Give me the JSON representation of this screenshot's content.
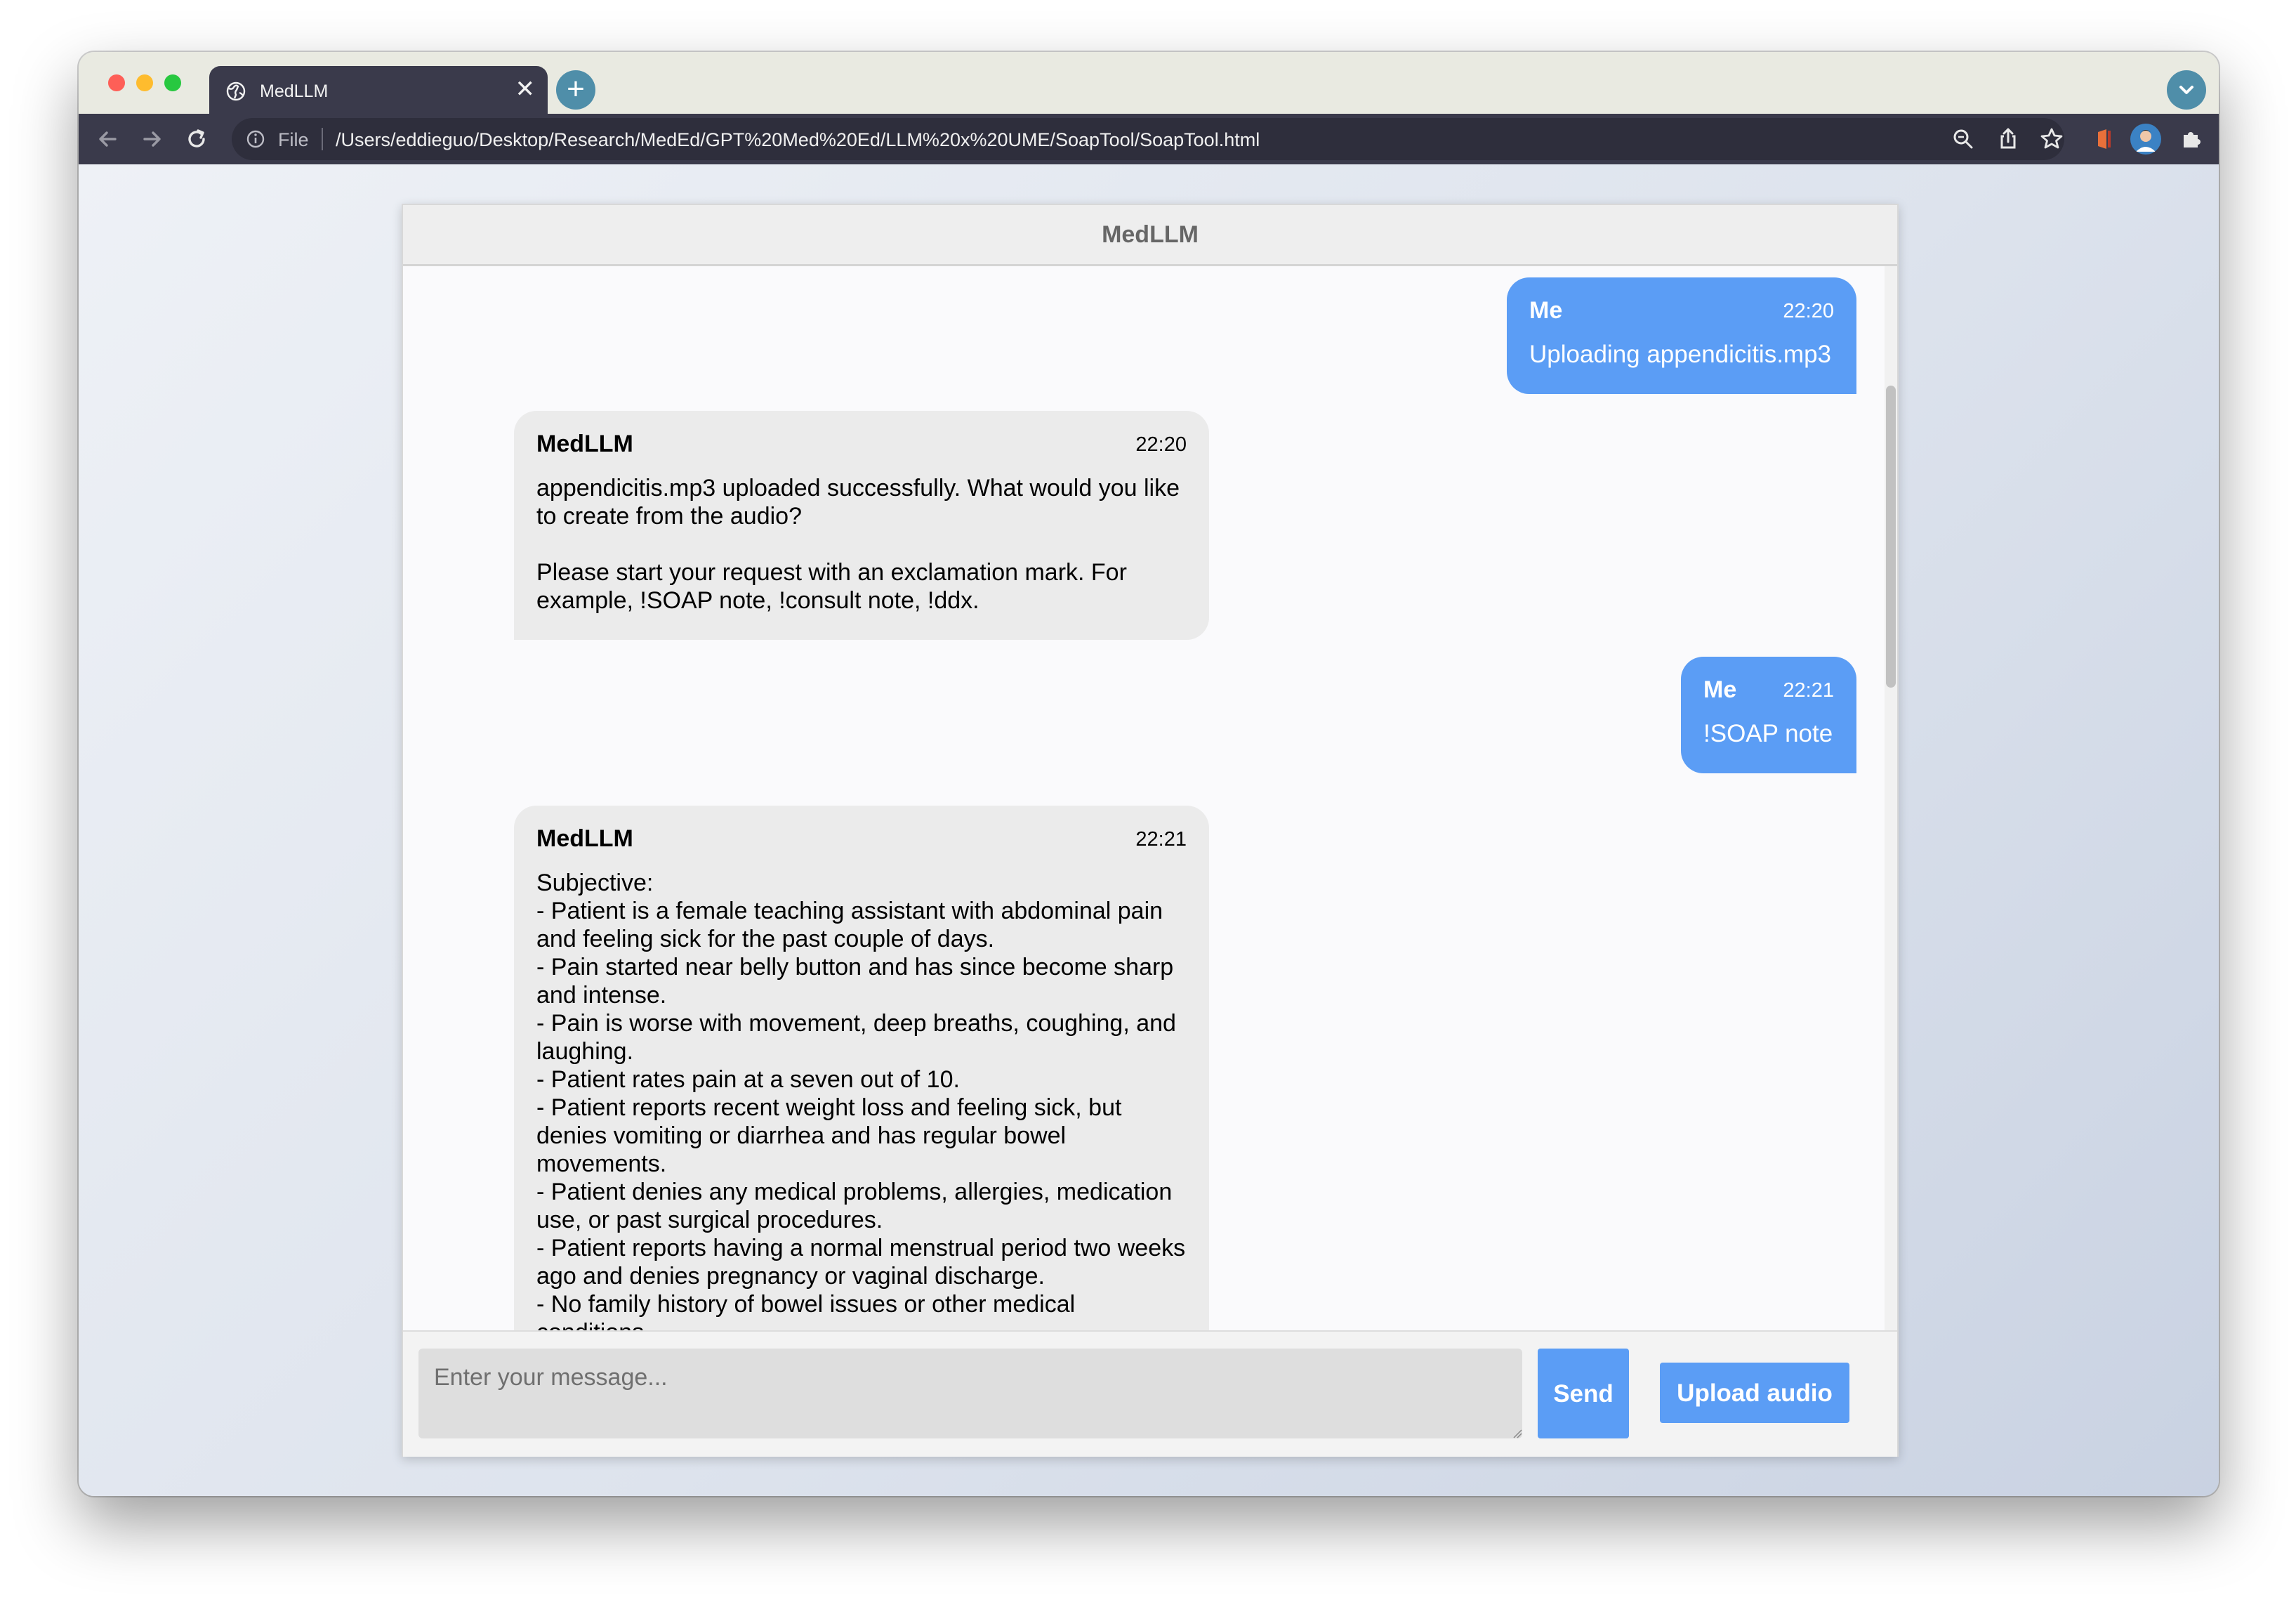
{
  "browser": {
    "tab_title": "MedLLM",
    "new_tab_label": "+",
    "close_tab_label": "✕",
    "url_scheme": "File",
    "url": "/Users/eddieguo/Desktop/Research/MedEd/GPT%20Med%20Ed/LLM%20x%20UME/SoapTool/SoapTool.html",
    "icons": [
      "back-icon",
      "forward-icon",
      "reload-icon",
      "info-icon",
      "zoom-icon",
      "share-icon",
      "bookmark-star-icon",
      "extension-flag-icon",
      "extension-recycle-icon",
      "extensions-puzzle-icon",
      "side-panel-icon",
      "profile-avatar-icon",
      "menu-kebab-icon"
    ]
  },
  "chat": {
    "title": "MedLLM",
    "messages": [
      {
        "sender": "Me",
        "time": "22:20",
        "text": "Uploading appendicitis.mp3"
      },
      {
        "sender": "MedLLM",
        "time": "22:20",
        "text": "appendicitis.mp3 uploaded successfully. What would you like to create from the audio?\n\nPlease start your request with an exclamation mark. For example, !SOAP note, !consult note, !ddx."
      },
      {
        "sender": "Me",
        "time": "22:21",
        "text": "!SOAP note"
      },
      {
        "sender": "MedLLM",
        "time": "22:21",
        "text": "Subjective:\n- Patient is a female teaching assistant with abdominal pain and feeling sick for the past couple of days.\n- Pain started near belly button and has since become sharp and intense.\n- Pain is worse with movement, deep breaths, coughing, and laughing.\n- Patient rates pain at a seven out of 10.\n- Patient reports recent weight loss and feeling sick, but denies vomiting or diarrhea and has regular bowel movements.\n- Patient denies any medical problems, allergies, medication use, or past surgical procedures.\n- Patient reports having a normal menstrual period two weeks ago and denies pregnancy or vaginal discharge.\n- No family history of bowel issues or other medical conditions."
      }
    ]
  },
  "composer": {
    "placeholder": "Enter your message...",
    "send_label": "Send",
    "upload_label": "Upload audio"
  },
  "colors": {
    "user_bubble": "#5b9df5",
    "bot_bubble": "#ebebeb",
    "button": "#5b9df5"
  }
}
